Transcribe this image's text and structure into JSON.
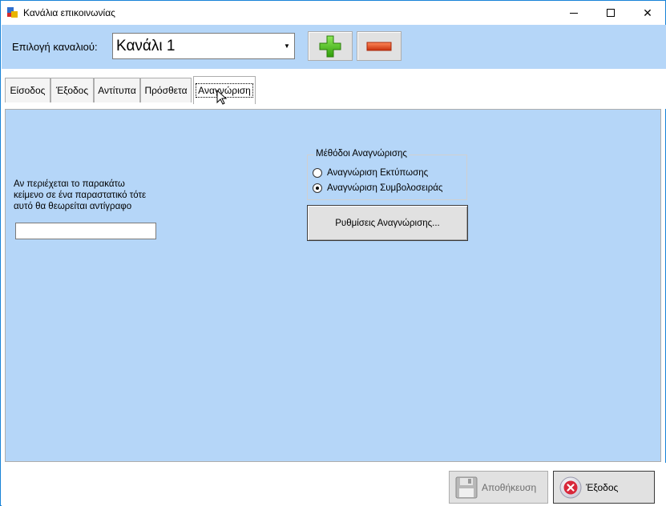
{
  "window": {
    "title": "Κανάλια επικοινωνίας",
    "controls": {
      "minimize": "minimize",
      "maximize": "maximize",
      "close": "✕"
    }
  },
  "header": {
    "channel_label": "Επιλογή καναλιού:",
    "channel_selected": "Κανάλι 1",
    "add_button_icon": "plus-icon",
    "remove_button_icon": "minus-icon"
  },
  "tabs": [
    {
      "label": "Είσοδος",
      "active": false
    },
    {
      "label": "Έξοδος",
      "active": false
    },
    {
      "label": "Αντίτυπα",
      "active": false
    },
    {
      "label": "Πρόσθετα",
      "active": false
    },
    {
      "label": "Αναγνώριση",
      "active": true
    }
  ],
  "panel": {
    "description_line1": "Αν περιέχεται το παρακάτω",
    "description_line2": "κείμενο σε ένα παραστατικό τότε",
    "description_line3": "αυτό θα θεωρείται αντίγραφο",
    "copy_text_value": "",
    "methods_group": {
      "title": "Μέθόδοι Αναγνώρισης",
      "options": [
        {
          "label": "Αναγνώριση Εκτύπωσης",
          "checked": false
        },
        {
          "label": "Αναγνώριση Συμβολοσειράς",
          "checked": true
        }
      ]
    },
    "settings_button": "Ρυθμίσεις Αναγνώρισης..."
  },
  "footer": {
    "save_label": "Αποθήκευση",
    "save_enabled": false,
    "exit_label": "Έξοδος"
  },
  "colors": {
    "panel_bg": "#b5d6f8",
    "add_green": "#4cc419",
    "remove_red": "#e0401a"
  }
}
